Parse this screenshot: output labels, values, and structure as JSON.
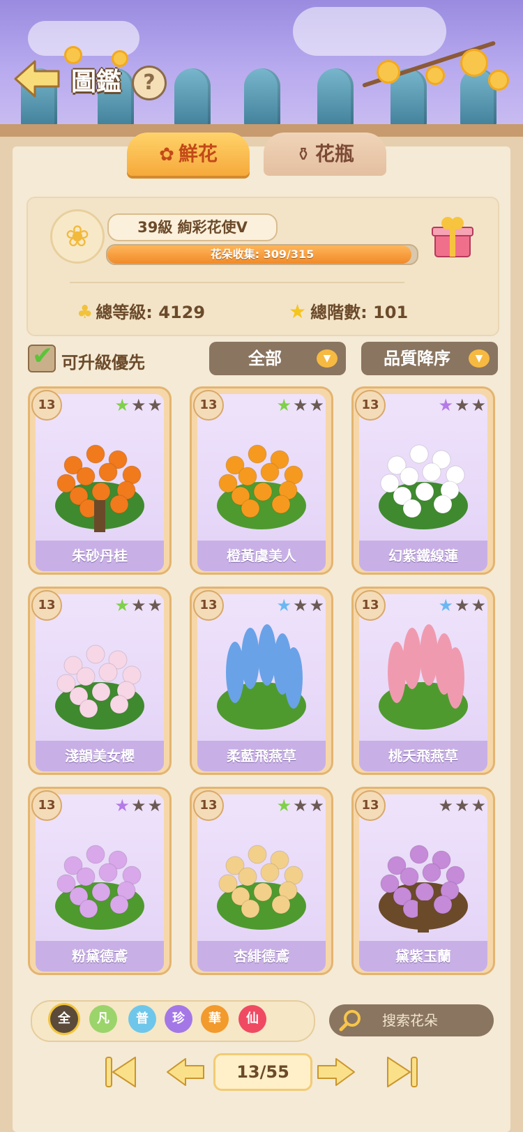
{
  "header": {
    "title": "圖鑑",
    "help_label": "?"
  },
  "tabs": [
    {
      "label": "鮮花",
      "active": true,
      "icon": "rose-icon"
    },
    {
      "label": "花瓶",
      "active": false,
      "icon": "vase-icon"
    }
  ],
  "profile": {
    "rank_text": "39級  絢彩花使Ⅴ",
    "progress_label": "花朵收集: 309/315",
    "progress": {
      "current": 309,
      "total": 315
    },
    "total_level_label": "總等級: 4129",
    "total_stage_label": "總階數: 101"
  },
  "filters": {
    "upgrade_first_label": "可升級優先",
    "upgrade_first_checked": true,
    "category": "全部",
    "sort": "品質降序"
  },
  "cards": [
    {
      "level": "13",
      "stars": [
        "green",
        "gray",
        "gray"
      ],
      "name": "朱砂丹桂",
      "plant": "orange-tree"
    },
    {
      "level": "13",
      "stars": [
        "green",
        "gray",
        "gray"
      ],
      "name": "橙黃虞美人",
      "plant": "orange-poppy"
    },
    {
      "level": "13",
      "stars": [
        "purple",
        "gray",
        "gray"
      ],
      "name": "幻紫鐵線蓮",
      "plant": "white-clematis"
    },
    {
      "level": "13",
      "stars": [
        "green",
        "gray",
        "gray"
      ],
      "name": "淺韻美女櫻",
      "plant": "pink-verbena"
    },
    {
      "level": "13",
      "stars": [
        "blue",
        "gray",
        "gray"
      ],
      "name": "柔藍飛燕草",
      "plant": "blue-delphinium"
    },
    {
      "level": "13",
      "stars": [
        "blue",
        "gray",
        "gray"
      ],
      "name": "桃夭飛燕草",
      "plant": "pink-delphinium"
    },
    {
      "level": "13",
      "stars": [
        "purple",
        "gray",
        "gray"
      ],
      "name": "粉黛德鳶",
      "plant": "pink-iris"
    },
    {
      "level": "13",
      "stars": [
        "green",
        "gray",
        "gray"
      ],
      "name": "杏緋德鳶",
      "plant": "apricot-iris"
    },
    {
      "level": "13",
      "stars": [
        "gray",
        "gray",
        "gray"
      ],
      "name": "黛紫玉蘭",
      "plant": "purple-magnolia"
    }
  ],
  "quality_chips": [
    {
      "label": "全",
      "color": "#5b4a3a",
      "selected": true
    },
    {
      "label": "凡",
      "color": "#9bd46a"
    },
    {
      "label": "普",
      "color": "#6ec7ea"
    },
    {
      "label": "珍",
      "color": "#a477e6"
    },
    {
      "label": "華",
      "color": "#f29a2c"
    },
    {
      "label": "仙",
      "color": "#f04a62"
    }
  ],
  "search": {
    "placeholder": "搜索花朵"
  },
  "pager": {
    "label": "13/55"
  },
  "colors": {
    "star_green": "#7fd04a",
    "star_blue": "#6ab8f2",
    "star_purple": "#b47ae8",
    "star_gray": "#6b5a54"
  }
}
